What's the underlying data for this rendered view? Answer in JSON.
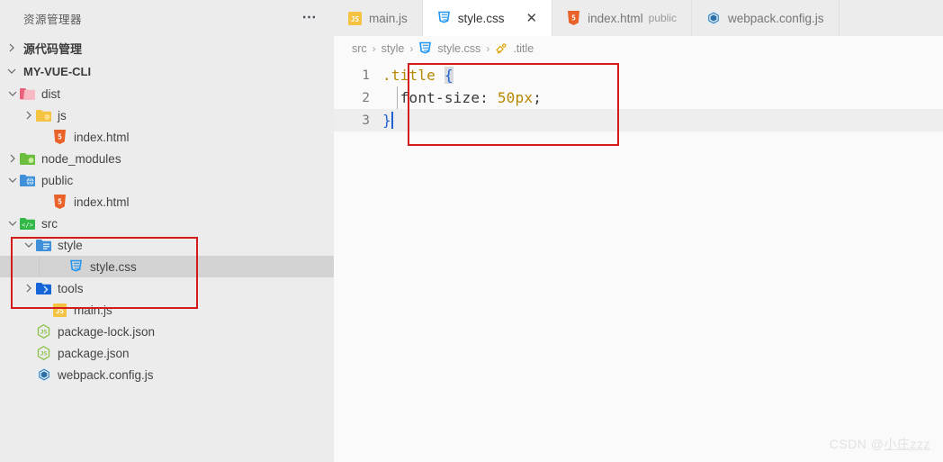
{
  "sidebar": {
    "header_title": "资源管理器",
    "more_icon": "ellipsis-icon",
    "sections": [
      {
        "label": "源代码管理",
        "expanded": false
      },
      {
        "label": "MY-VUE-CLI",
        "expanded": true
      }
    ],
    "tree": [
      {
        "label": "dist",
        "icon": "folder-dist-icon",
        "depth": 1,
        "type": "folder",
        "expanded": true,
        "selected": false
      },
      {
        "label": "js",
        "icon": "folder-js-icon",
        "depth": 2,
        "type": "folder",
        "expanded": false,
        "selected": false
      },
      {
        "label": "index.html",
        "icon": "html5-file-icon",
        "depth": 3,
        "type": "file",
        "selected": false
      },
      {
        "label": "node_modules",
        "icon": "folder-node-icon",
        "depth": 1,
        "type": "folder",
        "expanded": false,
        "selected": false
      },
      {
        "label": "public",
        "icon": "folder-public-icon",
        "depth": 1,
        "type": "folder",
        "expanded": true,
        "selected": false
      },
      {
        "label": "index.html",
        "icon": "html5-file-icon",
        "depth": 3,
        "type": "file",
        "selected": false
      },
      {
        "label": "src",
        "icon": "folder-src-icon",
        "depth": 1,
        "type": "folder",
        "expanded": true,
        "selected": false
      },
      {
        "label": "style",
        "icon": "folder-style-icon",
        "depth": 2,
        "type": "folder",
        "expanded": true,
        "selected": false
      },
      {
        "label": "style.css",
        "icon": "css3-file-icon",
        "depth": 4,
        "type": "file",
        "selected": true
      },
      {
        "label": "tools",
        "icon": "folder-tools-icon",
        "depth": 2,
        "type": "folder",
        "expanded": false,
        "selected": false
      },
      {
        "label": "main.js",
        "icon": "js-file-icon",
        "depth": 3,
        "type": "file",
        "selected": false
      },
      {
        "label": "package-lock.json",
        "icon": "nodejs-file-icon",
        "depth": 2,
        "type": "file",
        "selected": false
      },
      {
        "label": "package.json",
        "icon": "nodejs-file-icon",
        "depth": 2,
        "type": "file",
        "selected": false
      },
      {
        "label": "webpack.config.js",
        "icon": "webpack-file-icon",
        "depth": 2,
        "type": "file",
        "selected": false
      }
    ]
  },
  "tabs": [
    {
      "label": "main.js",
      "icon": "js-file-icon",
      "desc": "",
      "active": false,
      "closable": false
    },
    {
      "label": "style.css",
      "icon": "css3-file-icon",
      "desc": "",
      "active": true,
      "closable": true,
      "close_label": "✕"
    },
    {
      "label": "index.html",
      "icon": "html5-file-icon",
      "desc": "public",
      "active": false,
      "closable": false
    },
    {
      "label": "webpack.config.js",
      "icon": "webpack-file-icon",
      "desc": "",
      "active": false,
      "closable": false
    }
  ],
  "breadcrumb": {
    "separator": "›",
    "items": [
      {
        "label": "src",
        "icon": ""
      },
      {
        "label": "style",
        "icon": ""
      },
      {
        "label": "style.css",
        "icon": "css3-file-icon"
      },
      {
        "label": ".title",
        "icon": "css-selector-symbol-icon"
      }
    ]
  },
  "editor": {
    "language": "css",
    "active_line": 3,
    "lines": [
      {
        "number": "1",
        "tokens": [
          {
            "text": ".title ",
            "kind": "selector"
          },
          {
            "text": "{",
            "kind": "brace-highlight"
          }
        ]
      },
      {
        "number": "2",
        "tokens": [
          {
            "text": "  ",
            "kind": "plain"
          },
          {
            "text": "font-size",
            "kind": "property"
          },
          {
            "text": ": ",
            "kind": "punctuation"
          },
          {
            "text": "50px",
            "kind": "number"
          },
          {
            "text": ";",
            "kind": "punctuation"
          }
        ]
      },
      {
        "number": "3",
        "tokens": [
          {
            "text": "}",
            "kind": "brace"
          }
        ]
      }
    ]
  },
  "annotations": [
    {
      "name": "sidebar-src-style-highlight-box",
      "color": "#d41b1b"
    },
    {
      "name": "editor-code-highlight-box",
      "color": "#d41b1b"
    }
  ],
  "watermark": {
    "prefix": "CSDN ",
    "at": "@",
    "username": "小庄zzz"
  }
}
